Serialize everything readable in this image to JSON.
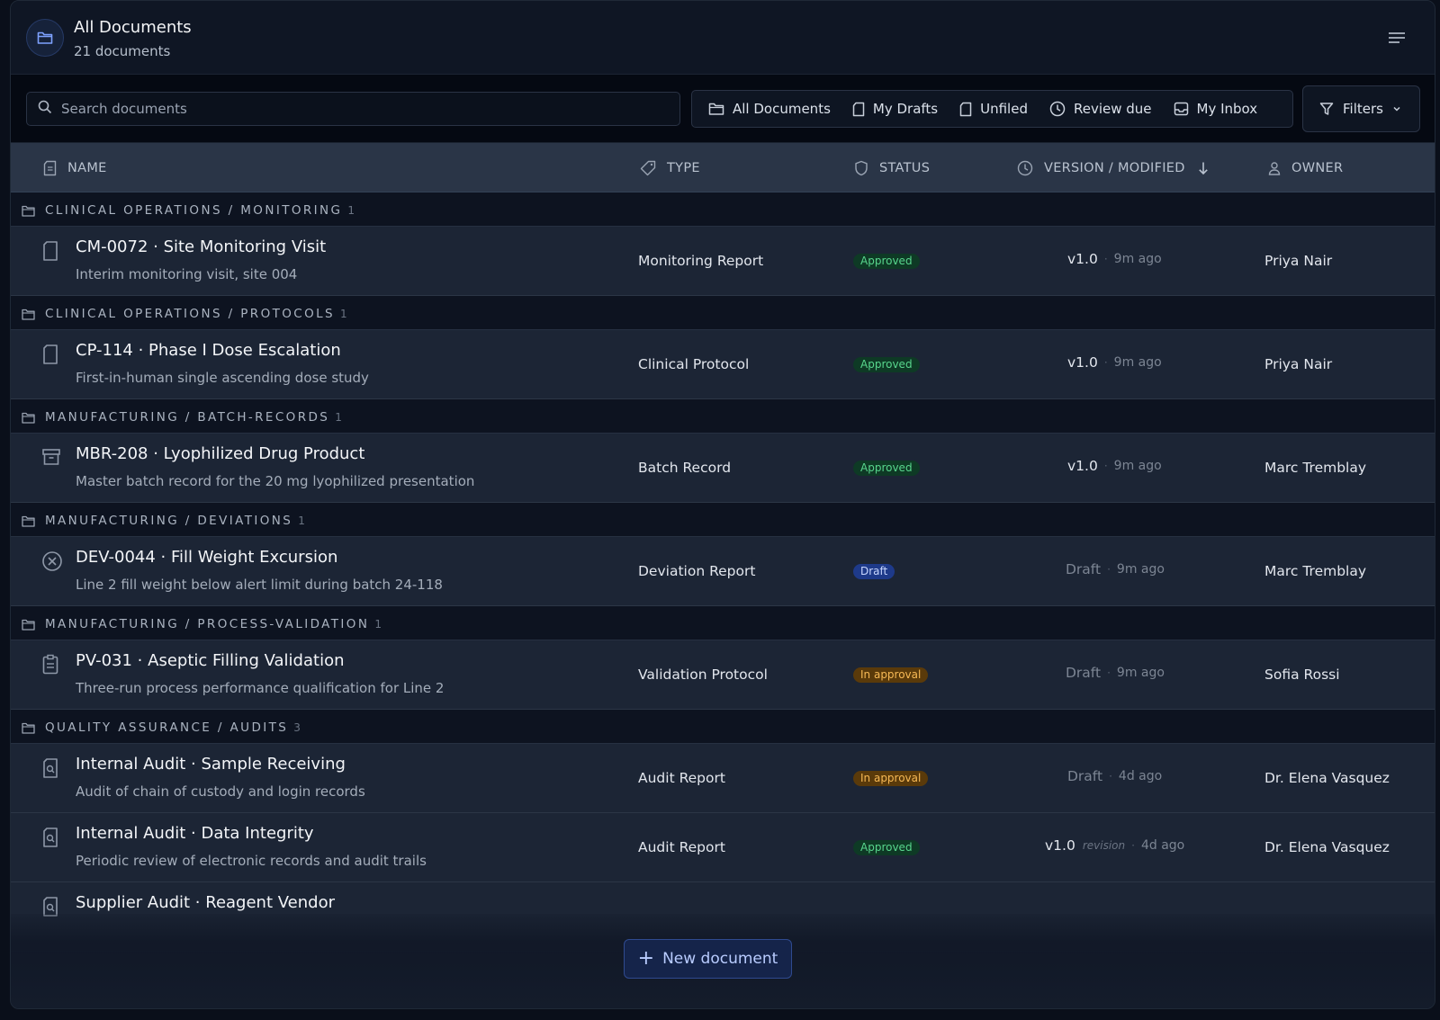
{
  "header": {
    "title": "All Documents",
    "subtitle": "21 documents"
  },
  "search": {
    "placeholder": "Search documents"
  },
  "views": [
    {
      "label": "All Documents",
      "icon": "folder-icon"
    },
    {
      "label": "My Drafts",
      "icon": "file-icon"
    },
    {
      "label": "Unfiled",
      "icon": "file-icon"
    },
    {
      "label": "Review due",
      "icon": "clock-icon"
    },
    {
      "label": "My Inbox",
      "icon": "inbox-icon"
    }
  ],
  "filters_label": "Filters",
  "columns": {
    "name": "NAME",
    "type": "TYPE",
    "status": "STATUS",
    "version": "VERSION / MODIFIED",
    "owner": "OWNER"
  },
  "groups": [
    {
      "label": "CLINICAL OPERATIONS / MONITORING",
      "count": "1"
    },
    {
      "label": "CLINICAL OPERATIONS / PROTOCOLS",
      "count": "1"
    },
    {
      "label": "MANUFACTURING / BATCH-RECORDS",
      "count": "1"
    },
    {
      "label": "MANUFACTURING / DEVIATIONS",
      "count": "1"
    },
    {
      "label": "MANUFACTURING / PROCESS-VALIDATION",
      "count": "1"
    },
    {
      "label": "QUALITY ASSURANCE / AUDITS",
      "count": "3"
    }
  ],
  "rows": [
    {
      "title": "CM-0072 · Site Monitoring Visit",
      "desc": "Interim monitoring visit, site 004",
      "type": "Monitoring Report",
      "status": "Approved",
      "version": "v1.0",
      "modified": "9m ago",
      "owner": "Priya Nair"
    },
    {
      "title": "CP-114 · Phase I Dose Escalation",
      "desc": "First-in-human single ascending dose study",
      "type": "Clinical Protocol",
      "status": "Approved",
      "version": "v1.0",
      "modified": "9m ago",
      "owner": "Priya Nair"
    },
    {
      "title": "MBR-208 · Lyophilized Drug Product",
      "desc": "Master batch record for the 20 mg lyophilized presentation",
      "type": "Batch Record",
      "status": "Approved",
      "version": "v1.0",
      "modified": "9m ago",
      "owner": "Marc Tremblay"
    },
    {
      "title": "DEV-0044 · Fill Weight Excursion",
      "desc": "Line 2 fill weight below alert limit during batch 24-118",
      "type": "Deviation Report",
      "status": "Draft",
      "version": "Draft",
      "modified": "9m ago",
      "owner": "Marc Tremblay"
    },
    {
      "title": "PV-031 · Aseptic Filling Validation",
      "desc": "Three-run process performance qualification for Line 2",
      "type": "Validation Protocol",
      "status": "In approval",
      "version": "Draft",
      "modified": "9m ago",
      "owner": "Sofia Rossi"
    },
    {
      "title": "Internal Audit · Sample Receiving",
      "desc": "Audit of chain of custody and login records",
      "type": "Audit Report",
      "status": "In approval",
      "version": "Draft",
      "modified": "4d ago",
      "owner": "Dr. Elena Vasquez"
    },
    {
      "title": "Internal Audit · Data Integrity",
      "desc": "Periodic review of electronic records and audit trails",
      "type": "Audit Report",
      "status": "Approved",
      "version": "v1.0",
      "revision": "revision",
      "modified": "4d ago",
      "owner": "Dr. Elena Vasquez"
    },
    {
      "title": "Supplier Audit · Reagent Vendor"
    }
  ],
  "new_button": "New document",
  "colors": {
    "approved": "#58d68d",
    "draft": "#c7d6ff",
    "in_approval": "#f7b955",
    "accent": "#2f4a8f"
  }
}
